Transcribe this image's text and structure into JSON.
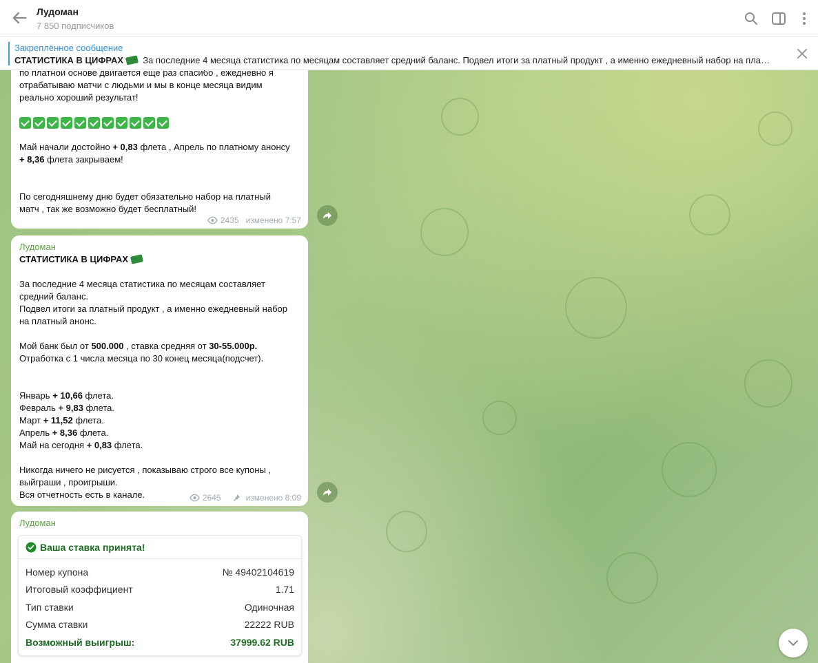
{
  "header": {
    "title": "Лудоман",
    "subscribers": "7 850 подписчиков"
  },
  "pinned": {
    "title": "Закреплённое сообщение",
    "bold": "СТАТИСТИКА В ЦИФРАХ",
    "text": "За последние 4 месяца статистика по месяцам составляет средний баланс. Подвел итоги за платный продукт , а именно ежедневный набор на пла…"
  },
  "messages": [
    {
      "line1": "по платной основе двигается еще раз спасибо , ежедневно я",
      "line2": "отрабатываю матчи с людьми и мы в конце месяца видим",
      "line3": "реально хороший результат!",
      "may_pre": "Май начали достойно ",
      "may_val": "+ 0,83",
      "may_mid": " флета  , Апрель по платному анонсу",
      "apr_val": "+ 8,36",
      "apr_post": " флета закрываем!",
      "line_today1": "По сегодняшнему дню будет обязательно набор на платный",
      "line_today2": "матч , так же возможно будет бесплатный!",
      "views": "2435",
      "edited": "изменено 7:57"
    },
    {
      "sender": "Лудоман",
      "heading": "СТАТИСТИКА В ЦИФРАХ",
      "p1a": "За последние 4 месяца статистика по месяцам составляет",
      "p1b": "средний баланс.",
      "p1c": "Подвел итоги за платный продукт , а именно ежедневный набор",
      "p1d": "на платный анонс.",
      "bank_pre": "Мой банк был от  ",
      "bank_val": "500.000",
      "bank_mid": " , ставка средняя от ",
      "bank_rate": "30-55.000р.",
      "p2": "Отработка с 1 числа месяца по 30 конец месяца(подсчет).",
      "months": [
        {
          "pre": "Январь ",
          "val": "+ 10,66",
          "post": " флета."
        },
        {
          "pre": "Февраль ",
          "val": "+ 9,83",
          "post": " флета."
        },
        {
          "pre": "Март ",
          "val": "+ 11,52",
          "post": " флета."
        },
        {
          "pre": "Апрель ",
          "val": "+ 8,36",
          "post": " флета."
        },
        {
          "pre": "Май на сегодня ",
          "val": "+ 0,83",
          "post": " флета."
        }
      ],
      "p3a": "Никогда ничего не рисуется , показываю строго все купоны ,",
      "p3b": "выйграши , проигрыши.",
      "p3c": "Вся отчетность есть в канале.",
      "views": "2645",
      "edited": "изменено 8:09"
    },
    {
      "sender": "Лудоман",
      "card": {
        "title": "Ваша ставка принята!",
        "rows": [
          {
            "label": "Номер купона",
            "value": "№ 49402104619"
          },
          {
            "label": "Итоговый коэффициент",
            "value": "1.71"
          },
          {
            "label": "Тип ставки",
            "value": "Одиночная"
          },
          {
            "label": "Сумма ставки",
            "value": "22222 RUB"
          }
        ],
        "win_label": "Возможный выигрыш:",
        "win_value": "37999.62 RUB"
      }
    }
  ]
}
